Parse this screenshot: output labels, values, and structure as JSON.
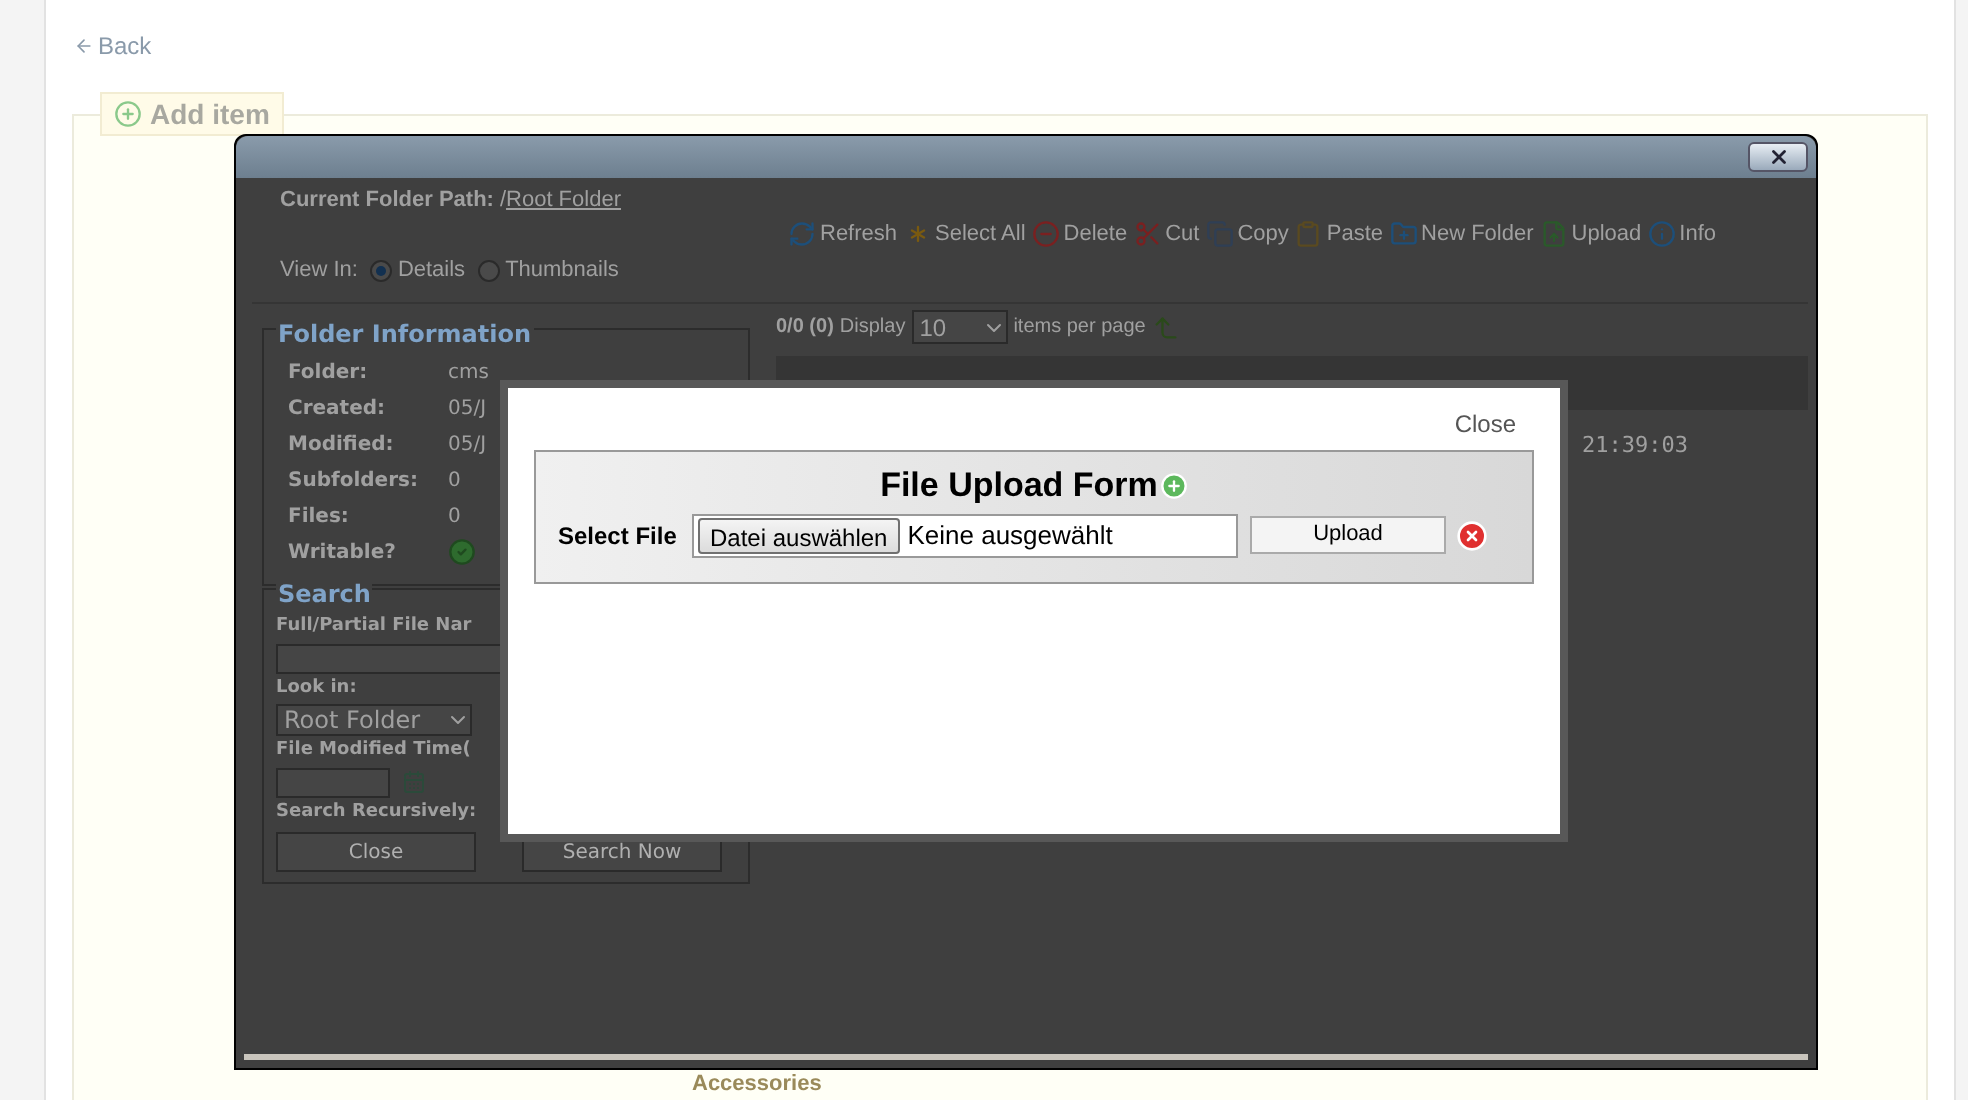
{
  "back_link": "Back",
  "add_item": {
    "legend": "Add item"
  },
  "file_manager": {
    "current_folder": {
      "label": "Current Folder Path:",
      "prefix": "/",
      "link": "Root Folder"
    },
    "view_in": {
      "label": "View In:",
      "options": [
        {
          "label": "Details",
          "selected": true
        },
        {
          "label": "Thumbnails",
          "selected": false
        }
      ]
    },
    "toolbar": [
      {
        "kind": "refresh",
        "label": "Refresh"
      },
      {
        "kind": "select_all",
        "label": "Select All"
      },
      {
        "kind": "delete",
        "label": "Delete"
      },
      {
        "kind": "cut",
        "label": "Cut"
      },
      {
        "kind": "copy",
        "label": "Copy"
      },
      {
        "kind": "paste",
        "label": "Paste"
      },
      {
        "kind": "new_folder",
        "label": "New Folder"
      },
      {
        "kind": "upload",
        "label": "Upload"
      },
      {
        "kind": "info",
        "label": "Info"
      }
    ],
    "folder_information": {
      "title": "Folder Information",
      "rows": [
        {
          "label": "Folder:",
          "value": "cms"
        },
        {
          "label": "Created:",
          "value": "05/J"
        },
        {
          "label": "Modified:",
          "value": "05/J"
        },
        {
          "label": "Subfolders:",
          "value": "0"
        },
        {
          "label": "Files:",
          "value": "0"
        }
      ],
      "writable_label": "Writable?"
    },
    "search": {
      "title": "Search",
      "name_label": "Full/Partial File Nar",
      "look_in_label": "Look in:",
      "look_in_value": "Root Folder",
      "modified_label": "File Modified Time(",
      "recursive_label": "Search Recursively:",
      "buttons": [
        "Close",
        "Search Now"
      ]
    },
    "paging": {
      "count": "0/0 (0)",
      "display_label": "Display",
      "page_size": "10",
      "suffix": "items per page"
    },
    "row_time": "21:39:03"
  },
  "below_text": "Accessories",
  "upload_dialog": {
    "close": "Close",
    "title": "File Upload Form",
    "select_label": "Select File",
    "choose_button": "Datei auswählen",
    "no_file": "Keine ausgewählt",
    "upload_button": "Upload"
  }
}
